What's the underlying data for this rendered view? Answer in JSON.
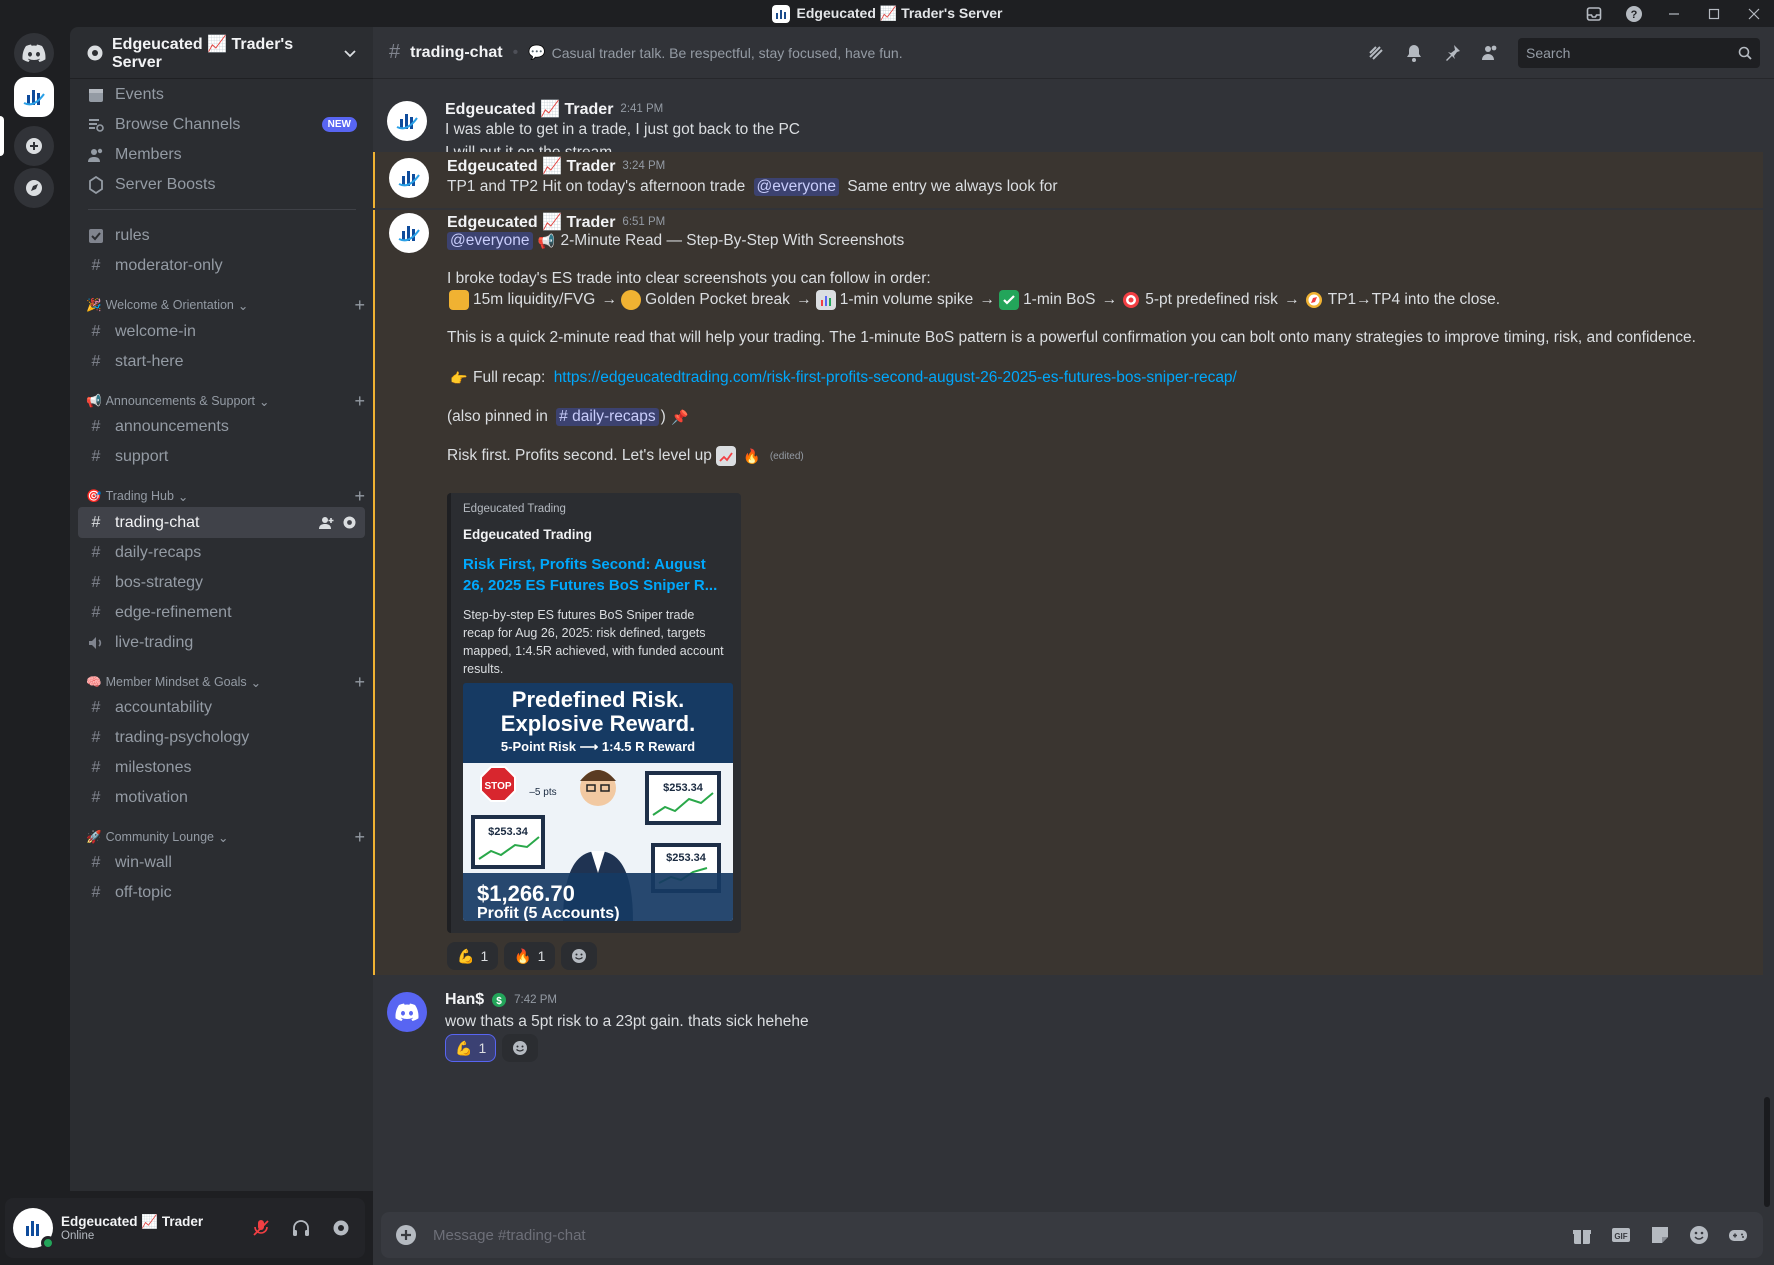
{
  "window": {
    "title": "Edgeucated 📈 Trader's Server"
  },
  "server": {
    "name": "Edgeucated 📈 Trader's Server"
  },
  "sidebar": {
    "top_items": [
      {
        "label": "Events",
        "icon": "calendar-icon"
      },
      {
        "label": "Browse Channels",
        "icon": "browse-icon",
        "badge": "NEW"
      },
      {
        "label": "Members",
        "icon": "members-icon"
      },
      {
        "label": "Server Boosts",
        "icon": "boost-icon"
      }
    ],
    "general": [
      {
        "label": "rules"
      },
      {
        "label": "moderator-only"
      }
    ],
    "categories": [
      {
        "name": "Welcome & Orientation",
        "emoji": "🎉",
        "channels": [
          "welcome-in",
          "start-here"
        ]
      },
      {
        "name": "Announcements & Support",
        "emoji": "📢",
        "channels": [
          "announcements",
          "support"
        ]
      },
      {
        "name": "Trading Hub",
        "emoji": "🎯",
        "channels": [
          "trading-chat",
          "daily-recaps",
          "bos-strategy",
          "edge-refinement",
          "live-trading"
        ]
      },
      {
        "name": "Member Mindset & Goals",
        "emoji": "🧠",
        "channels": [
          "accountability",
          "trading-psychology",
          "milestones",
          "motivation"
        ]
      },
      {
        "name": "Community Lounge",
        "emoji": "🚀",
        "channels": [
          "win-wall",
          "off-topic"
        ]
      }
    ]
  },
  "user": {
    "name": "Edgeucated 📈 Trader",
    "status": "Online"
  },
  "channel": {
    "name": "trading-chat",
    "topic": "Casual trader talk. Be respectful, stay focused, have fun.",
    "search_placeholder": "Search",
    "composer_placeholder": "Message #trading-chat"
  },
  "messages": {
    "m1": {
      "author": "Edgeucated 📈 Trader",
      "time": "2:41 PM",
      "line1": "I was able to get in a trade, I just got back to the PC",
      "line2": "I will put it on the stream"
    },
    "m2": {
      "author": "Edgeucated 📈 Trader",
      "time": "3:24 PM",
      "pre": "TP1 and TP2 Hit on today's afternoon trade",
      "mention": "@everyone",
      "post": "Same entry we always look for"
    },
    "m3": {
      "author": "Edgeucated 📈 Trader",
      "time": "6:51 PM",
      "mention": "@everyone",
      "headline": "2-Minute Read — Step-By-Step With Screenshots",
      "intro": "I broke today's ES trade into clear screenshots you can follow in order:",
      "steps": [
        "15m liquidity/FVG",
        "Golden Pocket break",
        "1-min volume spike",
        "1-min BoS",
        "5-pt predefined risk",
        "TP1→TP4 into the close."
      ],
      "para": "This is a quick 2-minute read that will help your trading. The 1-minute BoS pattern is a powerful confirmation you can bolt onto many strategies to improve timing, risk, and confidence.",
      "recap_label": "Full recap:",
      "recap_url": "https://edgeucatedtrading.com/risk-first-profits-second-august-26-2025-es-futures-bos-sniper-recap/",
      "pinned_pre": "(also pinned in",
      "pinned_channel": "daily-recaps",
      "pinned_post": ")",
      "closing": "Risk first. Profits second. Let's level up",
      "edited": "(edited)",
      "embed": {
        "provider": "Edgeucated Trading",
        "author": "Edgeucated Trading",
        "title": "Risk First, Profits Second: August 26, 2025 ES Futures BoS Sniper R...",
        "description": "Step-by-step ES futures BoS Sniper trade recap for Aug 26, 2025: risk defined, targets mapped, 1:4.5R achieved, with funded account results.",
        "image": {
          "headline1": "Predefined Risk.",
          "headline2": "Explosive Reward.",
          "subline": "5-Point Risk ⟶ 1:4.5 R Reward",
          "stop": "STOP",
          "pts": "–5 pts",
          "price1": "$253.34",
          "price2": "$253.34",
          "price3": "$253.34",
          "profit": "$1,266.70",
          "profit_sub": "Profit (5 Accounts)"
        }
      },
      "reactions": [
        {
          "emoji": "💪",
          "count": "1"
        },
        {
          "emoji": "🔥",
          "count": "1"
        }
      ]
    },
    "m4": {
      "author": "Han$",
      "time": "7:42 PM",
      "text": "wow thats a 5pt risk  to a 23pt gain. thats sick hehehe",
      "reactions": [
        {
          "emoji": "💪",
          "count": "1"
        }
      ]
    }
  },
  "colors": {
    "accent": "#5865f2",
    "mention_bg": "#3c4270",
    "highlight_border": "#f0b232",
    "link": "#00a8fc",
    "online": "#23a55a"
  }
}
